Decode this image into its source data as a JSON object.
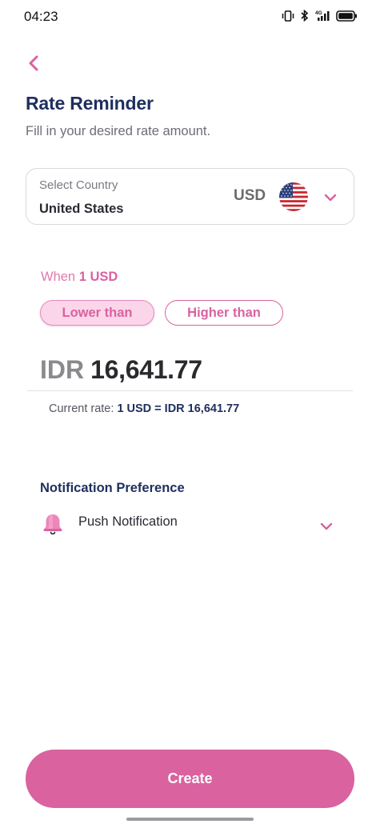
{
  "status_bar": {
    "time": "04:23",
    "network": "4G",
    "icons": [
      "vibrate-icon",
      "bluetooth-icon",
      "signal-icon",
      "battery-icon"
    ]
  },
  "header": {
    "back_icon": "chevron-left-icon",
    "title": "Rate Reminder",
    "subtitle": "Fill in your desired rate amount."
  },
  "country_select": {
    "label": "Select Country",
    "value": "United States",
    "currency": "USD",
    "flag_icon": "us-flag-icon",
    "chevron_icon": "chevron-down-icon"
  },
  "condition": {
    "when_prefix": "When",
    "when_amount": "1 USD",
    "options": [
      {
        "label": "Lower than",
        "selected": true
      },
      {
        "label": "Higher than",
        "selected": false
      }
    ]
  },
  "target_amount": {
    "currency": "IDR",
    "value": "16,641.77"
  },
  "current_rate": {
    "prefix": "Current rate:",
    "value": "1 USD = IDR 16,641.77"
  },
  "notification": {
    "title": "Notification Preference",
    "icon": "bell-icon",
    "selected": "Push Notification",
    "chevron_icon": "chevron-down-icon"
  },
  "actions": {
    "create_label": "Create"
  },
  "colors": {
    "accent": "#d9629f",
    "accent_light": "#fbd6ea",
    "title_navy": "#1e2f5e"
  }
}
